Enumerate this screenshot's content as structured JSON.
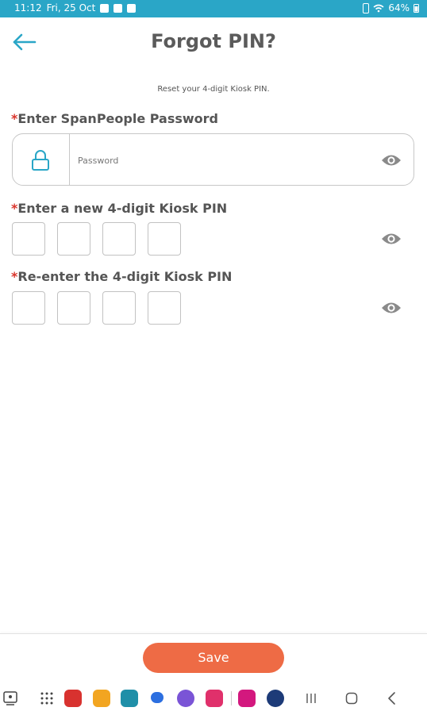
{
  "status_bar": {
    "time": "11:12",
    "date": "Fri, 25 Oct",
    "battery": "64%"
  },
  "header": {
    "title": "Forgot PIN?"
  },
  "subtitle": "Reset your 4-digit Kiosk PIN.",
  "password_section": {
    "required_mark": "*",
    "label": "Enter SpanPeople Password",
    "placeholder": "Password"
  },
  "new_pin_section": {
    "required_mark": "*",
    "label": "Enter a new 4-digit Kiosk PIN"
  },
  "confirm_pin_section": {
    "required_mark": "*",
    "label": "Re-enter the 4-digit Kiosk PIN"
  },
  "actions": {
    "save_label": "Save"
  },
  "colors": {
    "accent": "#2aa6c7",
    "save": "#ee6b45",
    "required": "#d9342b"
  },
  "dock_apps": [
    "gallery-app-icon",
    "apps-grid-icon",
    "app-red-icon",
    "files-app-icon",
    "calendar-app-icon",
    "messages-app-icon",
    "app-purple-icon",
    "app-pink-icon",
    "app-magenta-icon",
    "settings-app-icon"
  ]
}
